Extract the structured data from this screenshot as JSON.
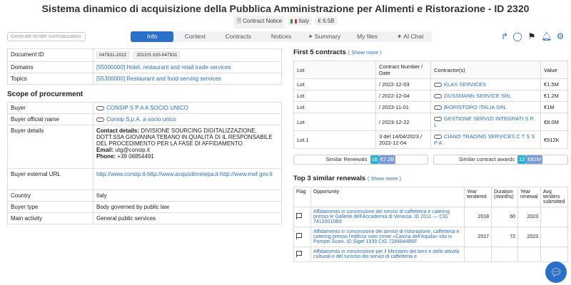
{
  "header": {
    "title": "Sistema dinamico di acquisizione della Pubblica Amministrazione per Alimenti e Ristorazione - ID 2320",
    "notice_type": "Contract Notice",
    "country": "Italy",
    "value": "€ 6.5B",
    "summarize_button": "Generate tender summarization"
  },
  "tabs": [
    "Info",
    "Context",
    "Contracts",
    "Notices",
    "✦ Summary",
    "My files",
    "✦ AI Chat"
  ],
  "info": {
    "document_id": {
      "label": "Document ID",
      "values": [
        "047931-2022",
        "2022/S 020-047931"
      ]
    },
    "domains": {
      "label": "Domains",
      "value": "[55000000] Hotel, restaurant and retail trade services"
    },
    "topics": {
      "label": "Topics",
      "value": "[55300000] Restaurant and food-serving services"
    }
  },
  "scope_title": "Scope of procurement",
  "scope": {
    "buyer": {
      "label": "Buyer",
      "value": "CONSIP S P A A SOCIO UNICO"
    },
    "buyer_official": {
      "label": "Buyer official name",
      "value": "Consip S.p.A. a socio unico"
    },
    "buyer_details": {
      "label": "Buyer details",
      "contact_label": "Contact details:",
      "contact_text": "DIVISIONE SOURCING DIGITALIZZAZIONE, DOTT.SSA GIOVANNA TEBANO IN QUALITÀ DI IL RESPONSABILE DEL PROCEDIMENTO PER LA FASE DI AFFIDAMENTO",
      "email_label": "Email:",
      "email": "utg@consip.it",
      "phone_label": "Phone:",
      "phone": "+39 06854491"
    },
    "buyer_url": {
      "label": "Buyer external URL",
      "value": "http://www.consip.it-http://www.acquistinretepa.it-http://www.mef.gov.it"
    },
    "country": {
      "label": "Country",
      "value": "Italy"
    },
    "buyer_type": {
      "label": "Buyer type",
      "value": "Body governed by public law"
    },
    "main_activity": {
      "label": "Main activity",
      "value": "General public services"
    }
  },
  "contracts": {
    "title": "First 5 contracts",
    "show_more": "( Show more )",
    "headers": [
      "Lot",
      "Contract Number / Date",
      "Contractor(s)",
      "Value"
    ],
    "rows": [
      {
        "lot": "Lot",
        "date": "/ 2022-12-03",
        "contractor": "KLAS SERVICES",
        "value": "€1.5M"
      },
      {
        "lot": "Lot",
        "date": "/ 2022-12-04",
        "contractor": "DUSSMANN SERVICE SRL",
        "value": "€1.2M"
      },
      {
        "lot": "Lot",
        "date": "/ 2023-11-01",
        "contractor": "BIORISTORO ITALIA SRL",
        "value": "€1M"
      },
      {
        "lot": "Lot",
        "date": "/ 2023-12-22",
        "contractor": "GESTIONE SERVIZI INTEGRATI S R L",
        "value": "€8.0M"
      },
      {
        "lot": "Lot 1",
        "date": "3 del 14/04/2023 / 2022-12-04",
        "contractor": "CIANO TRADING SERVICES C T S S P A",
        "value": "€512K"
      }
    ]
  },
  "similar": {
    "renewals_label": "Similar Renewals",
    "renewals_count": "16",
    "renewals_value": "€7.2B",
    "awards_label": "Similar contract awards",
    "awards_count": "12",
    "awards_value": "€82M"
  },
  "renewals": {
    "title": "Top 3 similar renewals",
    "show_more": "( Show more )",
    "headers": [
      "Flag",
      "Opportunity",
      "Year tendered",
      "Duration (months)",
      "Year renewal",
      "Avg tenders submitted"
    ],
    "rows": [
      {
        "opportunity": "Affidamento in concessione dei servizi di caffetteria e catering presso le Gallerie dell'Accademia di Venezia. ID 2011 — CIG 74120010B9",
        "year": "2018",
        "duration": "60",
        "renewal": "2023",
        "avg": ""
      },
      {
        "opportunity": "Affidamento in concessione dei servizi di ristorazione, caffetteria e catering presso l'edificio noto come «Casina dell'Aquila» sito in Pompei Scavi. ID Sigef 1939 CIG 7284844B6F",
        "year": "2017",
        "duration": "72",
        "renewal": "2023",
        "avg": ""
      },
      {
        "opportunity": "Affidamento in concessione per il Ministero dei beni e delle attività culturali e del turismo dei servizi di caffetteria e",
        "year": "",
        "duration": "",
        "renewal": "",
        "avg": ""
      }
    ]
  },
  "icons": [
    "share-icon",
    "comment-icon",
    "flag-icon",
    "bell-icon",
    "settings-icon",
    "chat-bubble-icon"
  ]
}
